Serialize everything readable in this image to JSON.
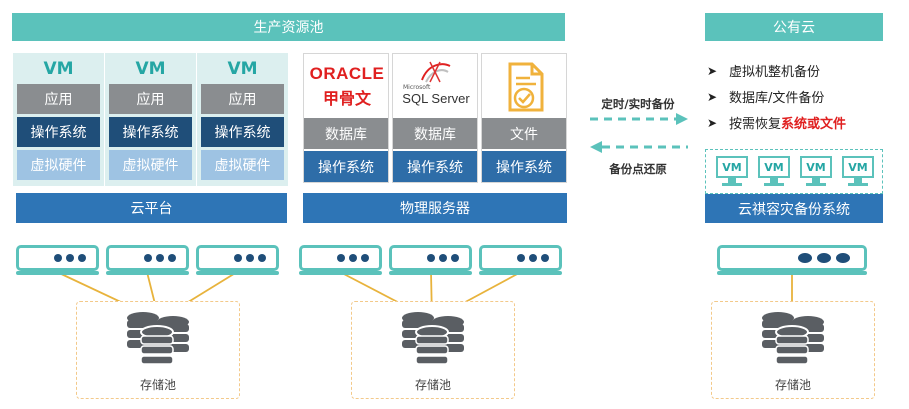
{
  "production_pool": {
    "title": "生产资源池",
    "vm_columns": [
      {
        "vm": "VM",
        "app": "应用",
        "os": "操作系统",
        "hw": "虚拟硬件"
      },
      {
        "vm": "VM",
        "app": "应用",
        "os": "操作系统",
        "hw": "虚拟硬件"
      },
      {
        "vm": "VM",
        "app": "应用",
        "os": "操作系统",
        "hw": "虚拟硬件"
      }
    ],
    "cloud_platform": "云平台",
    "servers": [
      {
        "logo": "ORACLE",
        "logo_sub": "甲骨文",
        "layer": "数据库",
        "os": "操作系统"
      },
      {
        "logo_small": "Microsoft",
        "logo": "SQL Server",
        "layer": "数据库",
        "os": "操作系统"
      },
      {
        "layer": "文件",
        "os": "操作系统"
      }
    ],
    "physical_server": "物理服务器",
    "storage_pool": "存储池"
  },
  "public_cloud": {
    "title": "公有云",
    "features": [
      {
        "text": "虚拟机整机备份"
      },
      {
        "text": "数据库/文件备份"
      },
      {
        "text": "按需恢复",
        "highlight": "系统或文件"
      }
    ],
    "vm_labels": [
      "VM",
      "VM",
      "VM",
      "VM"
    ],
    "system_name": "云祺容灾备份系统",
    "storage_pool": "存储池"
  },
  "arrows": {
    "backup": "定时/实时备份",
    "restore": "备份点还原"
  },
  "colors": {
    "teal": "#5bc2bb",
    "navy": "#1f4e79",
    "blue": "#2e75b6",
    "gray": "#8a8d90",
    "red": "#e02020",
    "gold": "#f0b23c"
  }
}
